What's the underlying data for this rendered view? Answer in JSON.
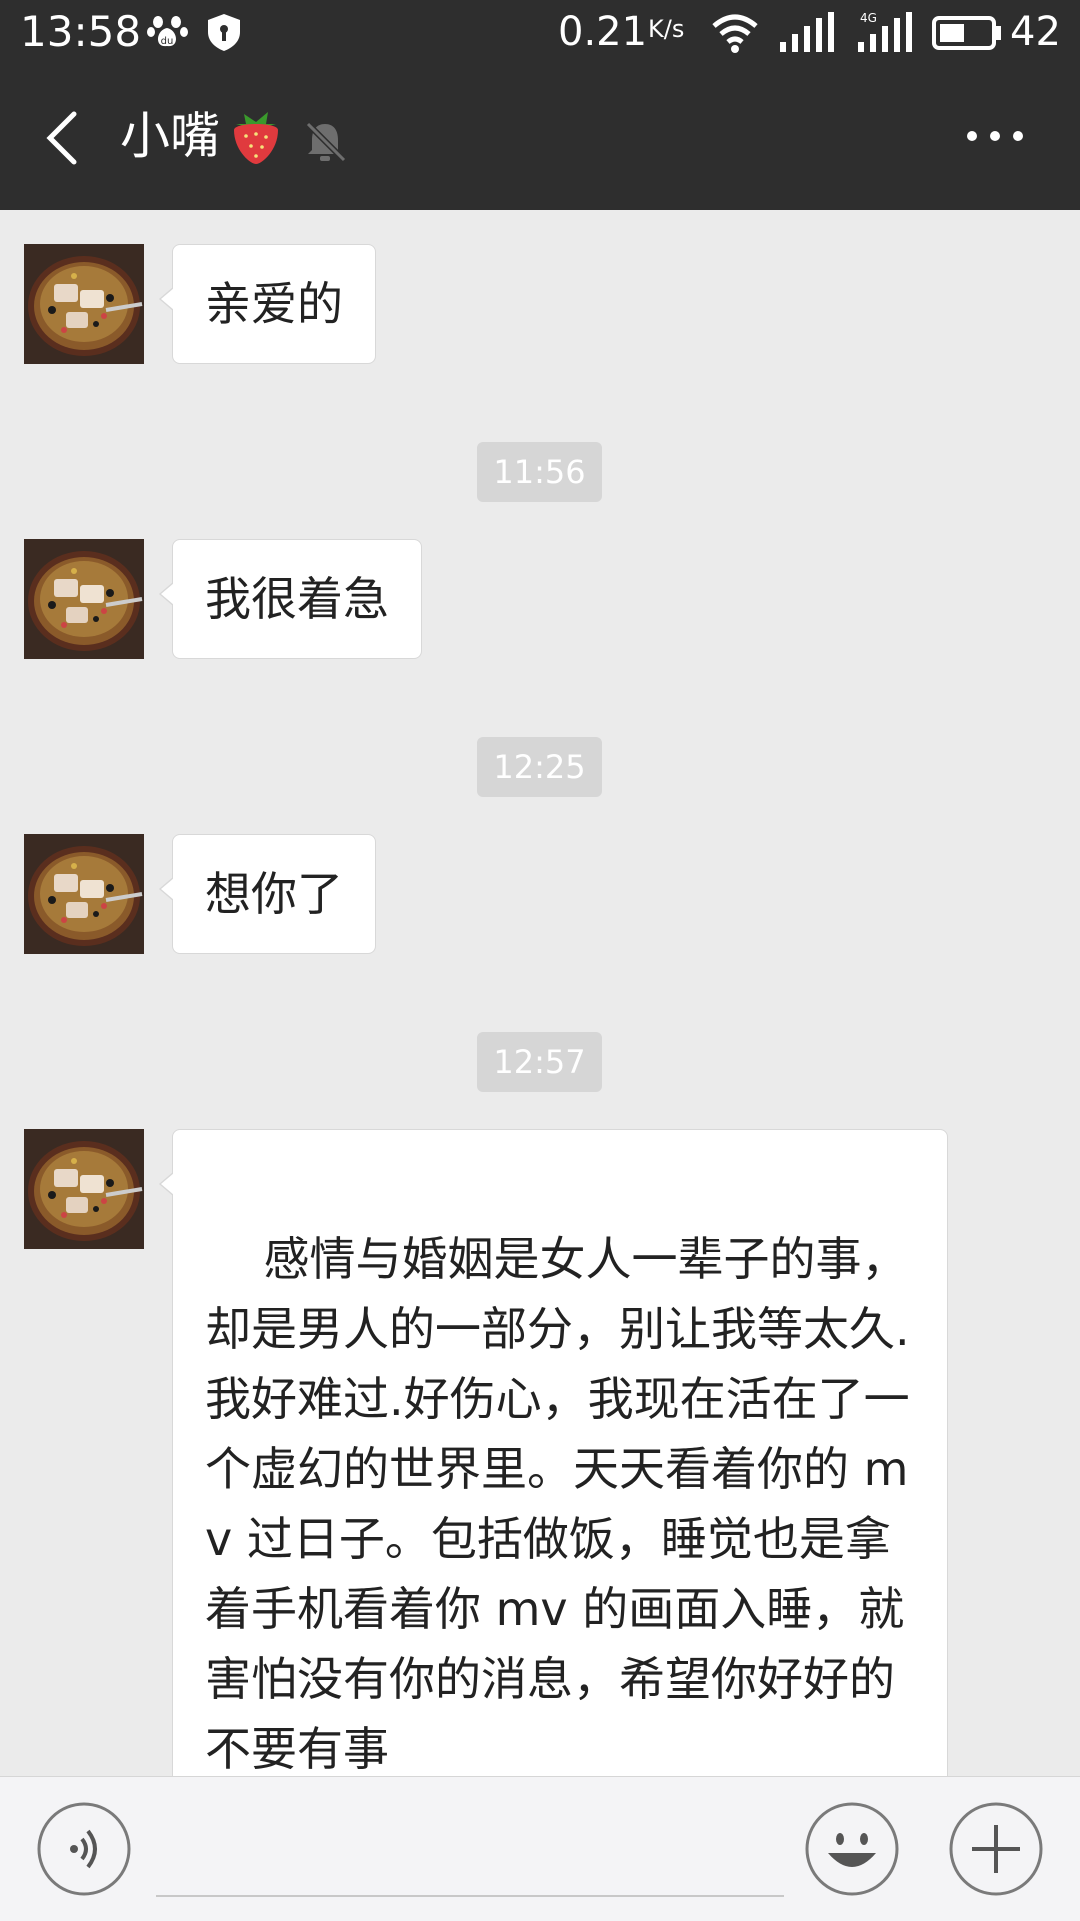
{
  "status_bar": {
    "time": "13:58",
    "net_speed": "0.21",
    "net_speed_unit": "K/s",
    "network_type": "4G",
    "battery": "42",
    "icons": [
      "baidu-paw-icon",
      "shield-icon",
      "wifi-icon",
      "signal-icon",
      "4g-signal-icon",
      "battery-icon"
    ]
  },
  "header": {
    "title": "小嘴",
    "title_emoji": "strawberry-icon",
    "back_icon": "back-arrow-icon",
    "mute_icon": "bell-muted-icon",
    "more_icon": "more-dots-icon"
  },
  "messages": [
    {
      "type": "text",
      "sender": "other",
      "text": "亲爱的"
    },
    {
      "type": "time",
      "text": "11:56"
    },
    {
      "type": "text",
      "sender": "other",
      "text": "我很着急"
    },
    {
      "type": "time",
      "text": "12:25"
    },
    {
      "type": "text",
      "sender": "other",
      "text": "想你了"
    },
    {
      "type": "time",
      "text": "12:57"
    },
    {
      "type": "text",
      "sender": "other",
      "text": "感情与婚姻是女人一辈子的事，却是男人的一部分，别让我等太久.我好难过.好伤心，我现在活在了一个虚幻的世界里。天天看着你的 mv 过日子。包括做饭，睡觉也是拿着手机看着你 mv 的画面入睡，就害怕没有你的消息，希望你好好的不要有事"
    }
  ],
  "input_bar": {
    "value": "",
    "icons": [
      "voice-icon",
      "emoji-icon",
      "plus-icon"
    ]
  },
  "colors": {
    "header_bg": "#2e2e2e",
    "chat_bg": "#ebebeb",
    "bubble_bg": "#ffffff",
    "timestamp_bg": "#d6d6d6"
  }
}
